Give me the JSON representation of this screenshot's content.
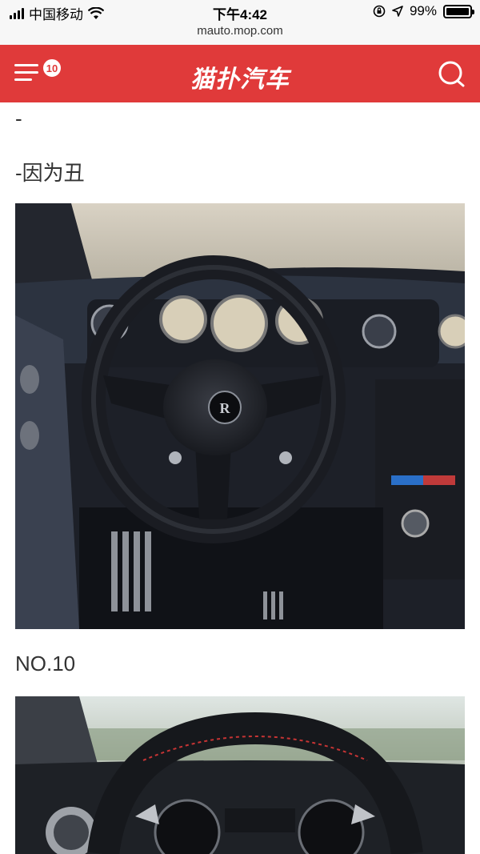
{
  "status_bar": {
    "carrier": "中国移动",
    "time": "下午4:42",
    "battery": "99%",
    "battery_level": 0.99,
    "url": "mauto.mop.com"
  },
  "header": {
    "badge_count": "10",
    "logo": "猫扑汽车",
    "brand_color": "#e03a3a"
  },
  "article": {
    "line1": "-",
    "line2": "-因为丑",
    "section_title": "NO.10"
  },
  "icons": [
    "wifi-icon",
    "signal-icon",
    "lock-rotation-icon",
    "location-icon",
    "battery-icon",
    "menu-icon",
    "search-icon"
  ]
}
